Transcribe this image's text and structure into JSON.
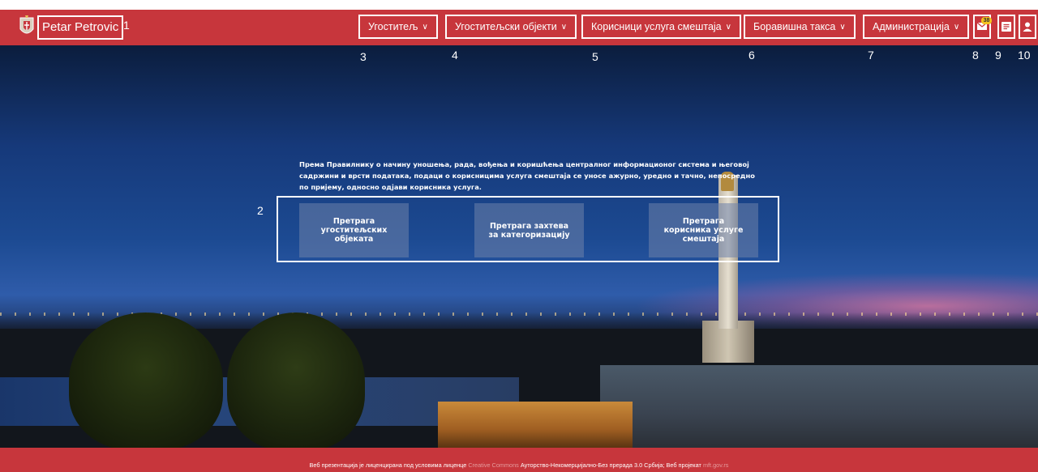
{
  "header": {
    "user_name": "Petar Petrovic",
    "menu": [
      {
        "label": "Угоститељ"
      },
      {
        "label": "Угоститељски објекти"
      },
      {
        "label": "Корисници услуга смештаја"
      },
      {
        "label": "Боравишна такса"
      },
      {
        "label": "Администрација"
      }
    ],
    "mail_badge": "38",
    "icons": [
      "mail-icon",
      "notes-icon",
      "user-icon"
    ],
    "color": "#c7363c"
  },
  "annotations": [
    "1",
    "2",
    "3",
    "4",
    "5",
    "6",
    "7",
    "8",
    "9",
    "10"
  ],
  "main": {
    "intro_text": "Према Правилнику о начину уношења, рада, вођења и коришћења централног информационог система и његовој садржини и врсти података, подаци о корисницима услуга смештаја се уносе ажурно, уредно и тачно, непосредно по пријему, односно одјави корисника услуга.",
    "actions": [
      {
        "label": "Претрага угоститељских објеката"
      },
      {
        "label": "Претрага захтева за категоризацију"
      },
      {
        "label": "Претрага корисника услуге смештаја"
      }
    ]
  },
  "footer": {
    "text_1": "Веб презентација је лиценцирана под условима лиценце",
    "link_1": "Creative Commons",
    "text_2": "Ауторство-Некомерцијално-Без прерада 3.0 Србија; Веб пројекат",
    "link_2": "mft.gov.rs"
  }
}
